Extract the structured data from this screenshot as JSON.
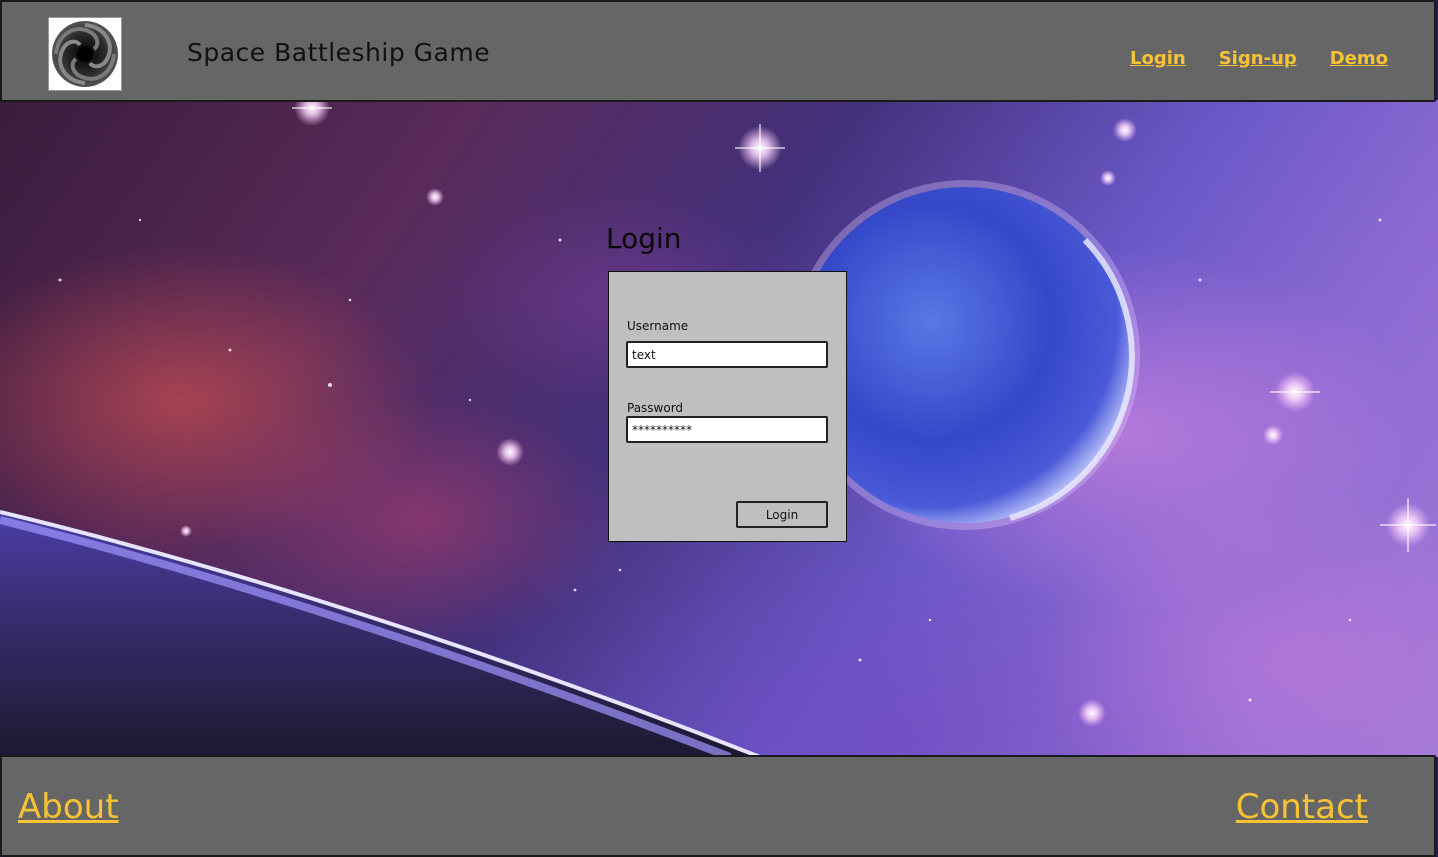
{
  "header": {
    "title": "Space Battleship Game",
    "logo_icon": "black-hole-logo-icon",
    "nav": {
      "login": "Login",
      "signup": "Sign-up",
      "demo": "Demo"
    }
  },
  "login": {
    "heading": "Login",
    "username_label": "Username",
    "username_value": "text",
    "password_label": "Password",
    "password_value": "**********",
    "button_label": "Login"
  },
  "footer": {
    "about": "About",
    "contact": "Contact"
  },
  "colors": {
    "bar_background": "#666666",
    "link_accent": "#f7c334",
    "panel_background": "#bfbfbf"
  }
}
